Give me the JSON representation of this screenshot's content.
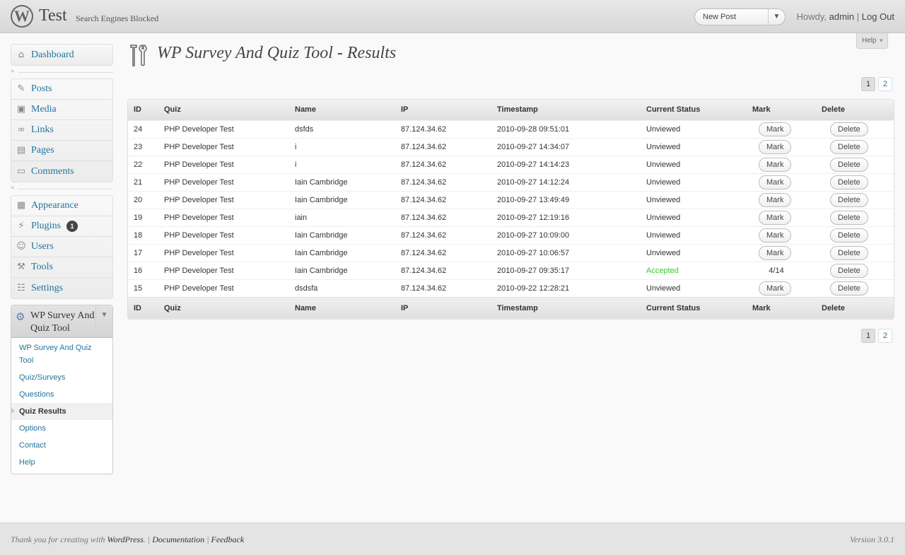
{
  "header": {
    "site_title": "Test",
    "site_note": "Search Engines Blocked",
    "favorite_action": "New Post",
    "howdy": "Howdy,",
    "username": "admin",
    "separator": "|",
    "logout": "Log Out",
    "help": "Help"
  },
  "menu": {
    "dashboard": "Dashboard",
    "posts": "Posts",
    "media": "Media",
    "links": "Links",
    "pages": "Pages",
    "comments": "Comments",
    "appearance": "Appearance",
    "plugins": "Plugins",
    "plugins_badge": "1",
    "users": "Users",
    "tools": "Tools",
    "settings": "Settings",
    "plugin_title": "WP Survey And Quiz Tool",
    "submenu": {
      "main": "WP Survey And Quiz Tool",
      "quizzes": "Quiz/Surveys",
      "questions": "Questions",
      "results": "Quiz Results",
      "options": "Options",
      "contact": "Contact",
      "help": "Help"
    }
  },
  "page": {
    "title": "WP Survey And Quiz Tool - Results",
    "pages": [
      "1",
      "2"
    ]
  },
  "table": {
    "columns": [
      "ID",
      "Quiz",
      "Name",
      "IP",
      "Timestamp",
      "Current Status",
      "Mark",
      "Delete"
    ],
    "mark_button": "Mark",
    "delete_button": "Delete",
    "rows": [
      {
        "id": "24",
        "quiz": "PHP Developer Test",
        "name": "dsfds",
        "ip": "87.124.34.62",
        "timestamp": "2010-09-28 09:51:01",
        "status": "Unviewed",
        "mark": ""
      },
      {
        "id": "23",
        "quiz": "PHP Developer Test",
        "name": "i",
        "ip": "87.124.34.62",
        "timestamp": "2010-09-27 14:34:07",
        "status": "Unviewed",
        "mark": ""
      },
      {
        "id": "22",
        "quiz": "PHP Developer Test",
        "name": "i",
        "ip": "87.124.34.62",
        "timestamp": "2010-09-27 14:14:23",
        "status": "Unviewed",
        "mark": ""
      },
      {
        "id": "21",
        "quiz": "PHP Developer Test",
        "name": "Iain Cambridge",
        "ip": "87.124.34.62",
        "timestamp": "2010-09-27 14:12:24",
        "status": "Unviewed",
        "mark": ""
      },
      {
        "id": "20",
        "quiz": "PHP Developer Test",
        "name": "Iain Cambridge",
        "ip": "87.124.34.62",
        "timestamp": "2010-09-27 13:49:49",
        "status": "Unviewed",
        "mark": ""
      },
      {
        "id": "19",
        "quiz": "PHP Developer Test",
        "name": "iain",
        "ip": "87.124.34.62",
        "timestamp": "2010-09-27 12:19:16",
        "status": "Unviewed",
        "mark": ""
      },
      {
        "id": "18",
        "quiz": "PHP Developer Test",
        "name": "Iain Cambridge",
        "ip": "87.124.34.62",
        "timestamp": "2010-09-27 10:09:00",
        "status": "Unviewed",
        "mark": ""
      },
      {
        "id": "17",
        "quiz": "PHP Developer Test",
        "name": "Iain Cambridge",
        "ip": "87.124.34.62",
        "timestamp": "2010-09-27 10:06:57",
        "status": "Unviewed",
        "mark": ""
      },
      {
        "id": "16",
        "quiz": "PHP Developer Test",
        "name": "Iain Cambridge",
        "ip": "87.124.34.62",
        "timestamp": "2010-09-27 09:35:17",
        "status": "Accepted",
        "mark": "4/14"
      },
      {
        "id": "15",
        "quiz": "PHP Developer Test",
        "name": "dsdsfa",
        "ip": "87.124.34.62",
        "timestamp": "2010-09-22 12:28:21",
        "status": "Unviewed",
        "mark": ""
      }
    ]
  },
  "colors": {
    "accepted": "#33cc33",
    "link": "#21759b"
  },
  "footer": {
    "thanks_prefix": "Thank you for creating with",
    "wordpress": "WordPress",
    "period": ".",
    "pipe": "|",
    "documentation": "Documentation",
    "feedback": "Feedback",
    "version": "Version 3.0.1"
  }
}
